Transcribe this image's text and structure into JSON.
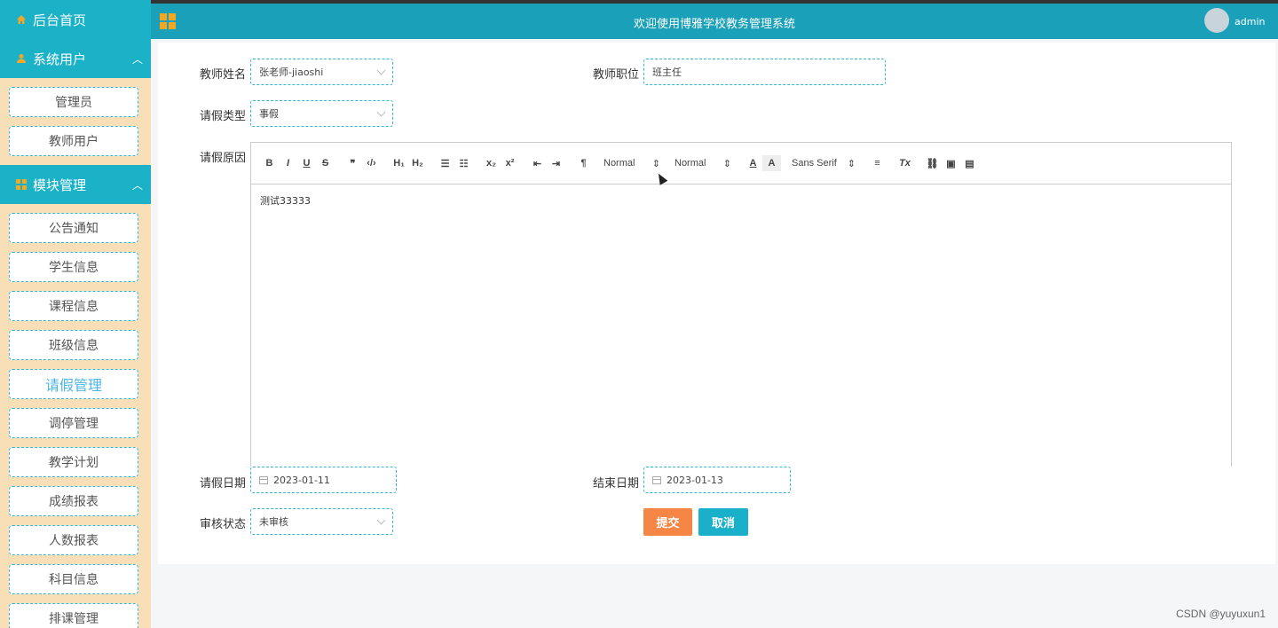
{
  "sidebar": {
    "home": {
      "label": "后台首页"
    },
    "groups": [
      {
        "label": "系统用户",
        "items": [
          {
            "label": "管理员"
          },
          {
            "label": "教师用户"
          }
        ]
      },
      {
        "label": "模块管理",
        "items": [
          {
            "label": "公告通知"
          },
          {
            "label": "学生信息"
          },
          {
            "label": "课程信息"
          },
          {
            "label": "班级信息"
          },
          {
            "label": "请假管理",
            "active": true
          },
          {
            "label": "调停管理"
          },
          {
            "label": "教学计划"
          },
          {
            "label": "成绩报表"
          },
          {
            "label": "人数报表"
          },
          {
            "label": "科目信息"
          },
          {
            "label": "排课管理"
          }
        ]
      }
    ]
  },
  "header": {
    "title": "欢迎使用博雅学校教务管理系统",
    "user": "admin"
  },
  "form": {
    "teacher_name": {
      "label": "教师姓名",
      "value": "张老师-jiaoshi"
    },
    "teacher_position": {
      "label": "教师职位",
      "value": "班主任"
    },
    "leave_type": {
      "label": "请假类型",
      "value": "事假"
    },
    "leave_reason": {
      "label": "请假原因",
      "content": "测试33333"
    },
    "leave_date": {
      "label": "请假日期",
      "value": "2023-01-11"
    },
    "end_date": {
      "label": "结束日期",
      "value": "2023-01-13"
    },
    "review_status": {
      "label": "审核状态",
      "value": "未审核"
    },
    "submit_label": "提交",
    "cancel_label": "取消"
  },
  "editor_toolbar": {
    "bold": "B",
    "italic": "I",
    "underline": "U",
    "strike": "S",
    "quote": "❞",
    "code": "‹/›",
    "h1": "H₁",
    "h2": "H₂",
    "ordered_list": "☰",
    "bullet_list": "☷",
    "subscript": "x₂",
    "superscript": "x²",
    "outdent": "⇤",
    "indent": "⇥",
    "direction": "¶",
    "size_select": "Normal",
    "header_select": "Normal",
    "font_color": "A",
    "background": "A",
    "font_select": "Sans Serif",
    "align": "≡",
    "clean": "Tx",
    "link": "⛓",
    "image": "▣",
    "video": "▤"
  },
  "watermark": "CSDN @yuyuxun1",
  "colors": {
    "accent": "#1bb2c8",
    "sidebar_bg": "#f8dfb7",
    "submit": "#f58646",
    "cancel": "#1ab0c9",
    "icon": "#f5a623"
  }
}
